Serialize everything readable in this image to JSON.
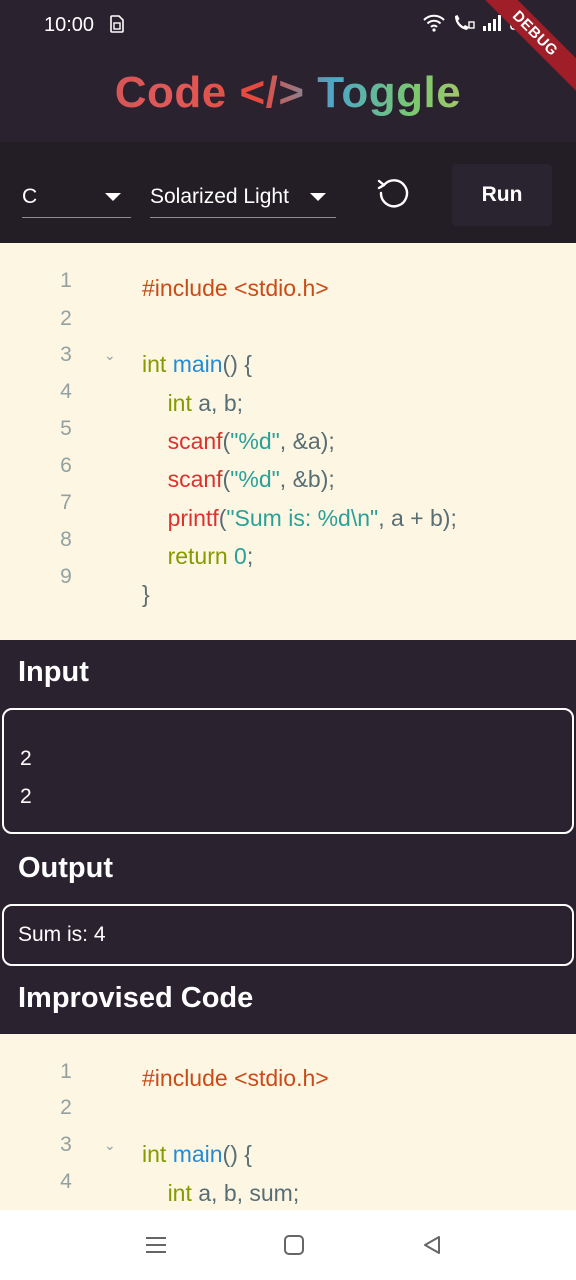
{
  "status_bar": {
    "time": "10:00",
    "sim_icon": "sim-icon",
    "debug_label": "DEBUG"
  },
  "app": {
    "title": "Code </> Toggle"
  },
  "toolbar": {
    "language": "C",
    "theme": "Solarized Light",
    "run_label": "Run"
  },
  "editor": {
    "line_numbers": [
      "1",
      "2",
      "3",
      "4",
      "5",
      "6",
      "7",
      "8",
      "9"
    ],
    "lines": [
      "#include <stdio.h>",
      "",
      "int main() {",
      "    int a, b;",
      "    scanf(\"%d\", &a);",
      "    scanf(\"%d\", &b);",
      "    printf(\"Sum is: %d\\n\", a + b);",
      "    return 0;",
      "}"
    ]
  },
  "input": {
    "title": "Input",
    "lines": [
      "2",
      "2"
    ]
  },
  "output": {
    "title": "Output",
    "text": "Sum is: 4"
  },
  "improvised": {
    "title": "Improvised Code",
    "line_numbers": [
      "1",
      "2",
      "3",
      "4"
    ],
    "lines": [
      "#include <stdio.h>",
      "",
      "int main() {",
      "    int a, b, sum;"
    ]
  },
  "colors": {
    "background": "#2b2230",
    "toolbar": "#231d26",
    "editor_bg": "#fdf6e3",
    "preprocessor": "#cb4b16",
    "keyword": "#859900",
    "function": "#268bd2",
    "string": "#2aa198",
    "call": "#dc322f"
  }
}
